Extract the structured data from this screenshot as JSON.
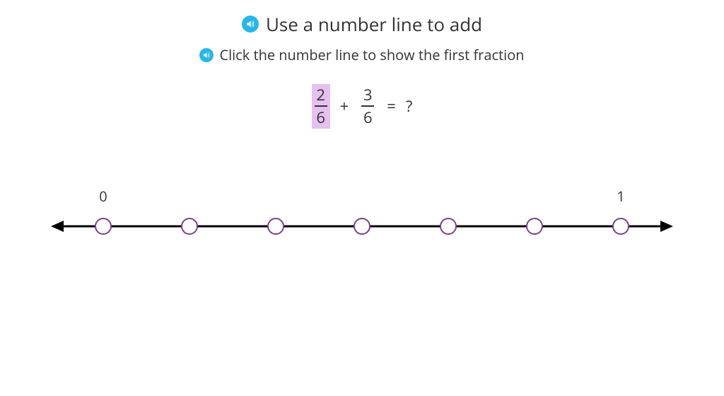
{
  "title": "Use a number line to add",
  "subtitle": "Click the number line to show the first fraction",
  "equation": {
    "frac1": {
      "num": "2",
      "den": "6",
      "highlight": true
    },
    "op": "+",
    "frac2": {
      "num": "3",
      "den": "6",
      "highlight": false
    },
    "eq": "=",
    "result": "?"
  },
  "number_line": {
    "ticks": 7,
    "labels": {
      "start": "0",
      "end": "1"
    },
    "colors": {
      "line": "#000000",
      "point_stroke": "#7b3f8c",
      "point_fill": "#ffffff"
    }
  }
}
